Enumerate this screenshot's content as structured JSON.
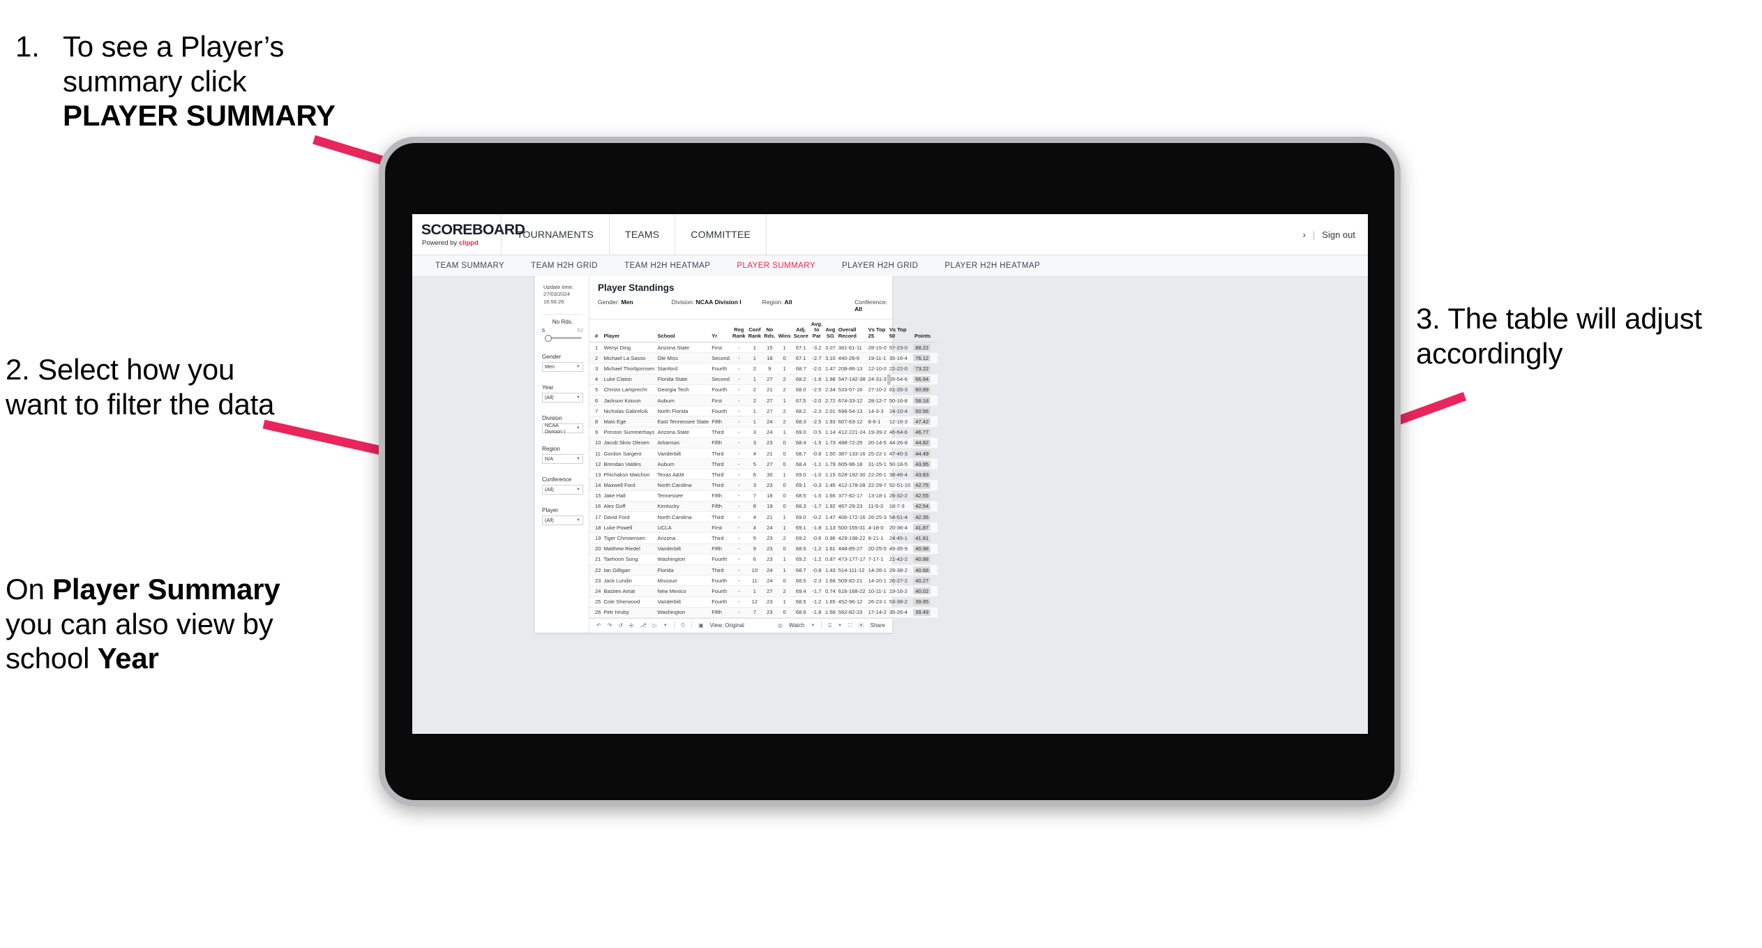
{
  "annotations": {
    "step1": {
      "number": "1.",
      "text_before": "To see a Player’s summary click ",
      "bold": "PLAYER SUMMARY"
    },
    "step2_line1": "2. Select how you want to filter the data",
    "step2_line2_before": "On ",
    "step2_bold1": "Player Summary",
    "step2_mid": " you can also view by school ",
    "step2_bold2": "Year",
    "step3": "3. The table will adjust accordingly"
  },
  "app": {
    "logo_main": "SCOREBOARD",
    "logo_sub_prefix": "Powered by ",
    "logo_sub_brand": "clippd",
    "topnav": [
      "TOURNAMENTS",
      "TEAMS",
      "COMMITTEE"
    ],
    "account_glyph": "›",
    "separator": "|",
    "sign_out": "Sign out",
    "accent_color": "#e8264e",
    "subnav": [
      {
        "label": "TEAM SUMMARY",
        "active": false
      },
      {
        "label": "TEAM H2H GRID",
        "active": false
      },
      {
        "label": "TEAM H2H HEATMAP",
        "active": false
      },
      {
        "label": "PLAYER SUMMARY",
        "active": true
      },
      {
        "label": "PLAYER H2H GRID",
        "active": false
      },
      {
        "label": "PLAYER H2H HEATMAP",
        "active": false
      }
    ]
  },
  "viz": {
    "update_label": "Update time:",
    "update_value": "27/03/2024 16:56:26",
    "title": "Player Standings",
    "meta": [
      {
        "label": "Gender: ",
        "value": "Men"
      },
      {
        "label": "Division: ",
        "value": "NCAA Division I"
      },
      {
        "label": "Region: ",
        "value": "All"
      },
      {
        "label": "Conference: ",
        "value": "All"
      }
    ],
    "filters": {
      "slider": {
        "label": "No Rds.",
        "min": "6",
        "max": "52"
      },
      "selects": [
        {
          "label": "Gender",
          "value": "Men"
        },
        {
          "label": "Year",
          "value": "(All)"
        },
        {
          "label": "Division",
          "value": "NCAA Division I"
        },
        {
          "label": "Region",
          "value": "N/A"
        },
        {
          "label": "Conference",
          "value": "(All)"
        },
        {
          "label": "Player",
          "value": "(All)"
        }
      ]
    },
    "toolbar": {
      "view_label": "View: Original",
      "watch_label": "Watch",
      "share_label": "Share"
    }
  },
  "table": {
    "headers": {
      "num": "#",
      "player": "Player",
      "school": "School",
      "yr": "Yr",
      "reg_rank_1": "Reg",
      "reg_rank_2": "Rank",
      "conf_rank_1": "Conf",
      "conf_rank_2": "Rank",
      "no_rds_1": "No",
      "no_rds_2": "Rds.",
      "wins": "Wins",
      "adj_1": "Adj.",
      "adj_2": "Score",
      "avgpar_1": "Avg.",
      "avgpar_2": "to Par",
      "avgsg_1": "Avg",
      "avgsg_2": "SG",
      "rec_1": "Overall",
      "rec_2": "Record",
      "top25": "Vs Top 25",
      "top50": "Vs Top 50",
      "points": "Points"
    },
    "rows": [
      [
        "1",
        "Wenyi Ding",
        "Arizona State",
        "First",
        "-",
        "1",
        "15",
        "1",
        "67.1",
        "-3.2",
        "3.07",
        "381-61-11",
        "28-15-0",
        "57-23-0",
        "88.22"
      ],
      [
        "2",
        "Michael La Sasso",
        "Ole Miss",
        "Second",
        "-",
        "1",
        "18",
        "0",
        "67.1",
        "-2.7",
        "3.10",
        "440-26-6",
        "19-11-1",
        "35-16-4",
        "76.12"
      ],
      [
        "3",
        "Michael Thorbjornsen",
        "Stanford",
        "Fourth",
        "-",
        "2",
        "9",
        "1",
        "68.7",
        "-2.0",
        "1.47",
        "208-86-13",
        "12-10-0",
        "22-22-0",
        "73.22"
      ],
      [
        "4",
        "Luke Claton",
        "Florida State",
        "Second",
        "-",
        "1",
        "27",
        "2",
        "68.2",
        "-1.6",
        "1.98",
        "547-142-38",
        "24-31-3",
        "65-54-6",
        "66.94"
      ],
      [
        "5",
        "Christo Lamprecht",
        "Georgia Tech",
        "Fourth",
        "-",
        "2",
        "21",
        "2",
        "68.0",
        "-2.5",
        "2.34",
        "533-57-16",
        "27-10-2",
        "61-20-3",
        "60.89"
      ],
      [
        "6",
        "Jackson Koivun",
        "Auburn",
        "First",
        "-",
        "2",
        "27",
        "1",
        "67.5",
        "-2.0",
        "2.72",
        "674-33-12",
        "28-12-7",
        "50-16-8",
        "58.18"
      ],
      [
        "7",
        "Nicholas Gabrelcik",
        "North Florida",
        "Fourth",
        "-",
        "1",
        "27",
        "2",
        "68.2",
        "-2.3",
        "2.01",
        "698-54-13",
        "14-3-3",
        "24-10-4",
        "50.56"
      ],
      [
        "8",
        "Mats Ege",
        "East Tennessee State",
        "Fifth",
        "-",
        "1",
        "24",
        "2",
        "68.3",
        "-2.5",
        "1.93",
        "607-63-12",
        "8-6-1",
        "12-16-3",
        "47.42"
      ],
      [
        "9",
        "Preston Summerhays",
        "Arizona State",
        "Third",
        "-",
        "3",
        "24",
        "1",
        "69.0",
        "-0.5",
        "1.14",
        "412-221-24",
        "19-39-2",
        "46-64-6",
        "46.77"
      ],
      [
        "10",
        "Jacob Skov Olesen",
        "Arkansas",
        "Fifth",
        "-",
        "3",
        "23",
        "0",
        "68.4",
        "-1.5",
        "1.73",
        "488-72-25",
        "20-14-5",
        "44-26-8",
        "44.82"
      ],
      [
        "11",
        "Gordon Sargent",
        "Vanderbilt",
        "Third",
        "-",
        "4",
        "21",
        "0",
        "68.7",
        "-0.8",
        "1.50",
        "387-133-16",
        "25-22-1",
        "47-40-3",
        "44.49"
      ],
      [
        "12",
        "Brendan Valdes",
        "Auburn",
        "Third",
        "-",
        "5",
        "27",
        "0",
        "68.4",
        "-1.1",
        "1.79",
        "605-96-18",
        "31-15-1",
        "50-18-5",
        "43.95"
      ],
      [
        "13",
        "Phichaksn Maichon",
        "Texas A&M",
        "Third",
        "-",
        "6",
        "30",
        "1",
        "69.0",
        "-1.0",
        "1.15",
        "628-192-30",
        "22-26-1",
        "38-46-4",
        "43.83"
      ],
      [
        "14",
        "Maxwell Ford",
        "North Carolina",
        "Third",
        "-",
        "3",
        "23",
        "0",
        "69.1",
        "-0.3",
        "1.45",
        "412-178-28",
        "22-29-7",
        "52-51-10",
        "42.75"
      ],
      [
        "15",
        "Jake Hall",
        "Tennessee",
        "Fifth",
        "-",
        "7",
        "18",
        "0",
        "68.5",
        "-1.5",
        "1.66",
        "377-82-17",
        "13-18-1",
        "26-32-2",
        "42.55"
      ],
      [
        "16",
        "Alex Goff",
        "Kentucky",
        "Fifth",
        "-",
        "8",
        "19",
        "0",
        "68.3",
        "-1.7",
        "1.92",
        "467-29-23",
        "11-5-3",
        "18-7-3",
        "42.54"
      ],
      [
        "17",
        "David Ford",
        "North Carolina",
        "Third",
        "-",
        "4",
        "21",
        "1",
        "69.0",
        "-0.2",
        "1.47",
        "406-172-16",
        "26-25-3",
        "54-51-4",
        "42.35"
      ],
      [
        "18",
        "Luke Powell",
        "UCLA",
        "First",
        "-",
        "4",
        "24",
        "1",
        "69.1",
        "-1.8",
        "1.13",
        "500-155-31",
        "4-18-0",
        "20-36-4",
        "41.87"
      ],
      [
        "19",
        "Tiger Christensen",
        "Arizona",
        "Third",
        "-",
        "5",
        "23",
        "2",
        "69.2",
        "-0.6",
        "0.96",
        "429-198-22",
        "8-21-1",
        "24-45-1",
        "41.81"
      ],
      [
        "20",
        "Matthew Riedel",
        "Vanderbilt",
        "Fifth",
        "-",
        "9",
        "23",
        "0",
        "68.5",
        "-1.2",
        "1.61",
        "448-85-27",
        "20-25-5",
        "49-35-9",
        "40.98"
      ],
      [
        "21",
        "Taehoon Song",
        "Washington",
        "Fourth",
        "-",
        "6",
        "23",
        "1",
        "69.2",
        "-1.2",
        "0.87",
        "473-177-17",
        "7-17-1",
        "21-42-2",
        "40.88"
      ],
      [
        "22",
        "Ian Gilligan",
        "Florida",
        "Third",
        "-",
        "10",
        "24",
        "1",
        "68.7",
        "-0.8",
        "1.43",
        "514-111-12",
        "14-26-1",
        "29-38-2",
        "40.68"
      ],
      [
        "23",
        "Jack Lundin",
        "Missouri",
        "Fourth",
        "-",
        "11",
        "24",
        "0",
        "68.5",
        "-2.3",
        "1.68",
        "509-82-21",
        "14-20-1",
        "26-27-2",
        "40.27"
      ],
      [
        "24",
        "Bastien Amat",
        "New Mexico",
        "Fourth",
        "-",
        "1",
        "27",
        "2",
        "69.4",
        "-1.7",
        "0.74",
        "616-168-22",
        "10-11-1",
        "19-16-2",
        "40.02"
      ],
      [
        "25",
        "Cole Sherwood",
        "Vanderbilt",
        "Fourth",
        "-",
        "12",
        "23",
        "1",
        "68.5",
        "-1.2",
        "1.65",
        "452-96-12",
        "26-23-1",
        "53-38-2",
        "39.95"
      ],
      [
        "26",
        "Petr Hruby",
        "Washington",
        "Fifth",
        "-",
        "7",
        "23",
        "0",
        "68.6",
        "-1.8",
        "1.56",
        "562-82-23",
        "17-14-2",
        "35-26-4",
        "39.49"
      ]
    ]
  }
}
